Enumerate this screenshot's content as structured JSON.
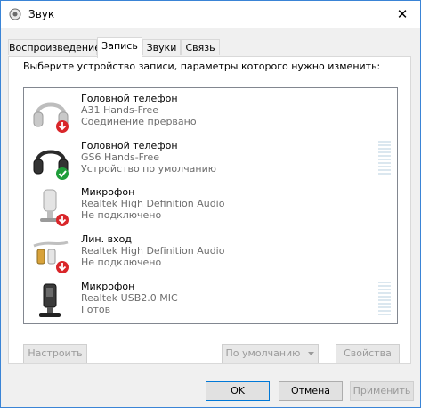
{
  "window": {
    "title": "Звук",
    "close_glyph": "✕"
  },
  "tabs": [
    {
      "label": "Воспроизведение",
      "active": false
    },
    {
      "label": "Запись",
      "active": true
    },
    {
      "label": "Звуки",
      "active": false
    },
    {
      "label": "Связь",
      "active": false
    }
  ],
  "recording": {
    "instruction": "Выберите устройство записи, параметры которого нужно изменить:",
    "devices": [
      {
        "name": "Головной телефон",
        "driver": "A31 Hands-Free",
        "status": "Соединение прервано",
        "icon": "headset-icon",
        "badge": "disconnected-arrow-badge",
        "meter": false
      },
      {
        "name": "Головной телефон",
        "driver": "GS6 Hands-Free",
        "status": "Устройство по умолчанию",
        "icon": "headset-icon",
        "badge": "default-check-badge",
        "meter": true
      },
      {
        "name": "Микрофон",
        "driver": "Realtek High Definition Audio",
        "status": "Не подключено",
        "icon": "microphone-icon",
        "badge": "disconnected-arrow-badge",
        "meter": false
      },
      {
        "name": "Лин. вход",
        "driver": "Realtek High Definition Audio",
        "status": "Не подключено",
        "icon": "line-in-cable-icon",
        "badge": "disconnected-arrow-badge",
        "meter": false
      },
      {
        "name": "Микрофон",
        "driver": "Realtek USB2.0 MIC",
        "status": "Готов",
        "icon": "usb-microphone-icon",
        "badge": "none",
        "meter": true
      }
    ]
  },
  "buttons": {
    "configure": "Настроить",
    "set_default": "По умолчанию",
    "properties": "Свойства",
    "ok": "OK",
    "cancel": "Отмена",
    "apply": "Применить"
  },
  "colors": {
    "accent": "#0078d7",
    "arrow_badge": "#d9262a",
    "check_badge": "#1f9d3a",
    "meter": "#dbe7ef"
  }
}
